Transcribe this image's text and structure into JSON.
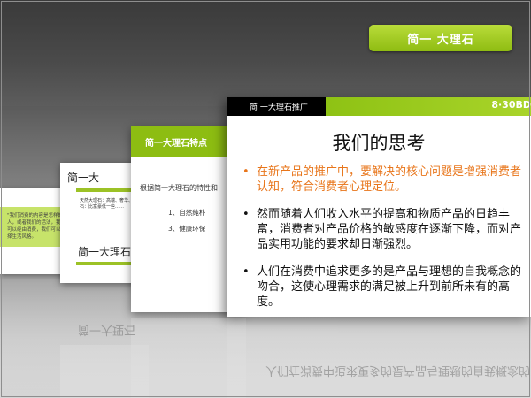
{
  "header": {
    "tab_title": "简一 大理石"
  },
  "slide1": {
    "quote": "\"我们消费的内容是怎样的人，或者我们的活法，我们可以经由消费，我们可以选择生活风格。"
  },
  "slide2": {
    "title": "简一大",
    "text": "天然大理石：高端、奢华、仿大理石：比富豪低一些……",
    "title2": "简一大理石"
  },
  "slide3": {
    "title": "简一大理石特点",
    "intro": "根据简一大理石的特性和",
    "bullets": [
      "1、自然纯朴",
      "3、健康环保"
    ]
  },
  "main_slide": {
    "header_label": "简 一大理石推广",
    "time": "8·30BD",
    "title": "我们的思考",
    "bullets": [
      {
        "text": "在新产品的推广中，要解决的核心问题是增强消费者认知，符合消费者心理定位。",
        "color": "#e8751a"
      },
      {
        "text": "然而随着人们收入水平的提高和物质产品的日趋丰富，消费者对产品价格的敏感度在逐渐下降，而对产品实用功能的要求却日渐强烈。",
        "color": "#111111"
      },
      {
        "text": "人们在消费中追求更多的是产品与理想的自我概念的吻合，这使心理需求的满足被上升到前所未有的高度。",
        "color": "#111111"
      }
    ]
  },
  "colors": {
    "accent_green": "#8dbd12",
    "accent_orange": "#e8751a"
  }
}
